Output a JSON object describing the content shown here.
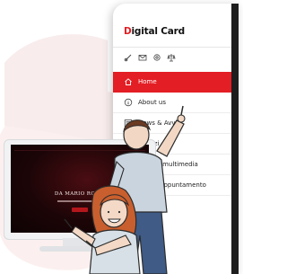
{
  "phone": {
    "logo_prefix": "D",
    "logo_rest": "igital Card",
    "social_icons": [
      "link-icon",
      "mail-icon",
      "settings-icon",
      "scale-icon"
    ],
    "menu": [
      {
        "label": "Home",
        "icon": "home-icon",
        "active": true
      },
      {
        "label": "About us",
        "icon": "info-icon",
        "active": false
      },
      {
        "label": "News & Avvisi",
        "icon": "news-icon",
        "active": false
      },
      {
        "label": "Servizi",
        "icon": "services-icon",
        "active": false
      },
      {
        "label": "Gallery multimedia",
        "icon": "gallery-icon",
        "active": false
      },
      {
        "label": "Prendi appuntamento",
        "icon": "calendar-icon",
        "active": false
      }
    ]
  },
  "monitor": {
    "hero_title": "DA MARIO ROSSI"
  },
  "colors": {
    "brand_red": "#e31e24",
    "monitor_dark": "#1c0507",
    "blob": "#fbf0ef"
  }
}
